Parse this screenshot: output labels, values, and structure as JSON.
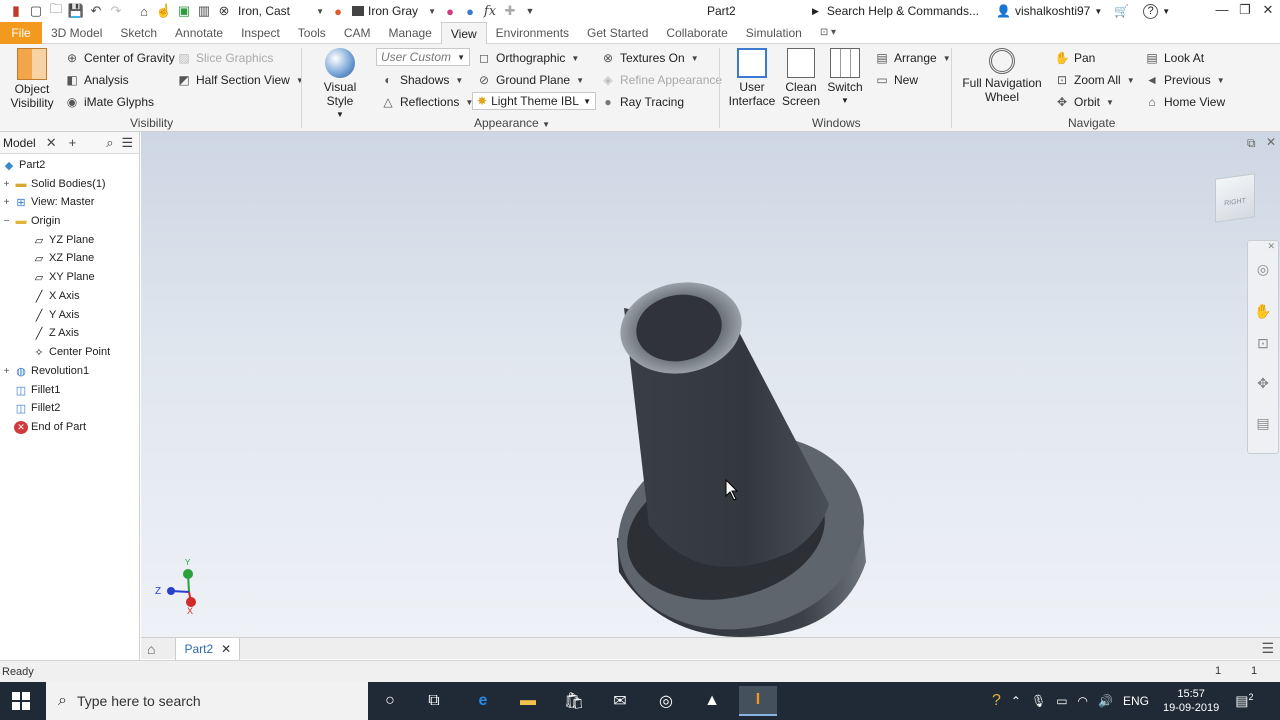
{
  "qat": {
    "material": "Iron, Cast",
    "appearance": "Iron Gray",
    "doc_title": "Part2",
    "search_placeholder": "Search Help & Commands...",
    "username": "vishalkoshti97",
    "fx_icon": "fx"
  },
  "tabs": [
    "File",
    "3D Model",
    "Sketch",
    "Annotate",
    "Inspect",
    "Tools",
    "CAM",
    "Manage",
    "View",
    "Environments",
    "Get Started",
    "Collaborate",
    "Simulation"
  ],
  "ribbon": {
    "visibility": {
      "object_visibility": "Object Visibility",
      "center_of_gravity": "Center of Gravity",
      "analysis": "Analysis",
      "imate_glyphs": "iMate Glyphs",
      "slice_graphics": "Slice Graphics",
      "half_section_view": "Half Section View",
      "label": "Visibility"
    },
    "appearance": {
      "visual_style": "Visual Style",
      "user_custom": "User Custom",
      "orthographic": "Orthographic",
      "textures_on": "Textures On",
      "shadows": "Shadows",
      "ground_plane": "Ground Plane",
      "refine_appearance": "Refine Appearance",
      "reflections": "Reflections",
      "light_theme": "Light Theme IBL",
      "ray_tracing": "Ray Tracing",
      "label": "Appearance"
    },
    "windows": {
      "user_interface": "User Interface",
      "clean_screen": "Clean Screen",
      "switch": "Switch",
      "arrange": "Arrange",
      "new": "New",
      "label": "Windows"
    },
    "navigate": {
      "full_nav_wheel": "Full Navigation Wheel",
      "pan": "Pan",
      "zoom_all": "Zoom All",
      "orbit": "Orbit",
      "look_at": "Look At",
      "previous": "Previous",
      "home_view": "Home View",
      "label": "Navigate"
    }
  },
  "browser": {
    "title": "Model",
    "tree": [
      {
        "label": "Part2"
      },
      {
        "label": "Solid Bodies(1)"
      },
      {
        "label": "View: Master"
      },
      {
        "label": "Origin"
      },
      {
        "label": "YZ Plane"
      },
      {
        "label": "XZ Plane"
      },
      {
        "label": "XY Plane"
      },
      {
        "label": "X Axis"
      },
      {
        "label": "Y Axis"
      },
      {
        "label": "Z Axis"
      },
      {
        "label": "Center Point"
      },
      {
        "label": "Revolution1"
      },
      {
        "label": "Fillet1"
      },
      {
        "label": "Fillet2"
      },
      {
        "label": "End of Part"
      }
    ]
  },
  "viewport": {
    "viewcube_label": "RIGHT",
    "triad": {
      "y": "Y",
      "z": "Z",
      "x": "X"
    }
  },
  "doc_tab": "Part2",
  "status": {
    "text": "Ready",
    "count1": "1",
    "count2": "1"
  },
  "taskbar": {
    "search_placeholder": "Type here to search",
    "language": "ENG",
    "time": "15:57",
    "date": "19-09-2019",
    "notifications": "2"
  },
  "colors": {
    "file_tab": "#f39a1e",
    "taskbar": "#1f2a36",
    "part_body": "#3b4047"
  }
}
